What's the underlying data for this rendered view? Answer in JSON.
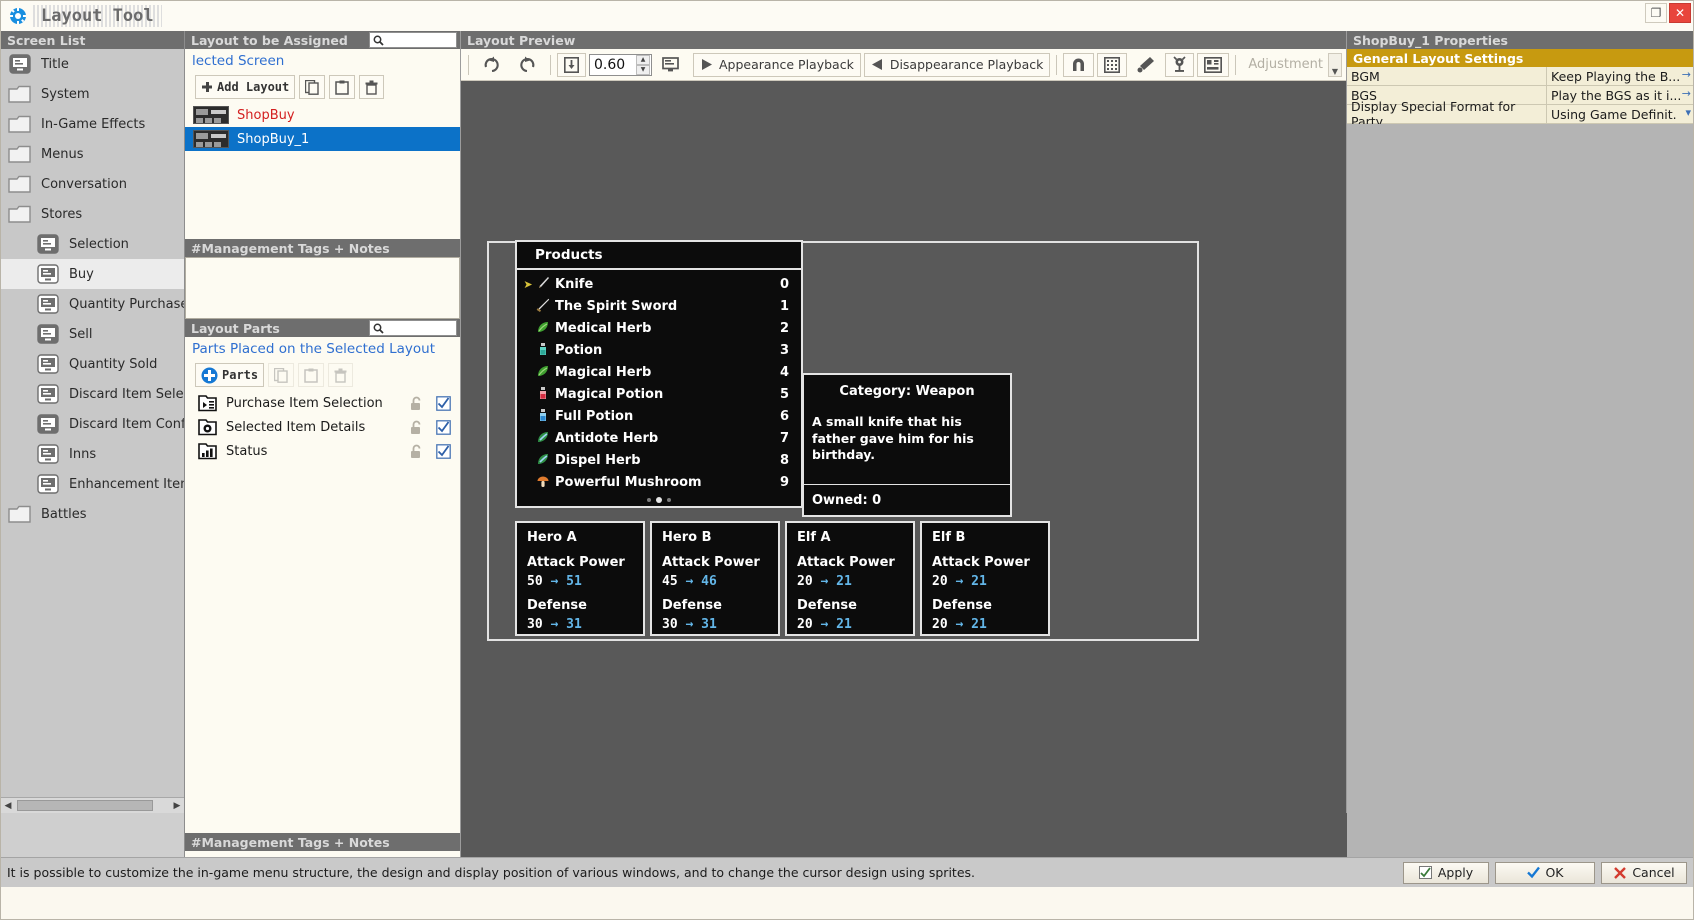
{
  "window": {
    "title": "Layout Tool",
    "logo_icon": "blue-gear-icon",
    "restore_label": "❐",
    "close_label": "✕"
  },
  "screen_list": {
    "header": "Screen List",
    "items": [
      {
        "label": "Title",
        "icon": "screen-icon",
        "indent": false,
        "selected": false
      },
      {
        "label": "System",
        "icon": "folder-icon",
        "indent": false,
        "selected": false
      },
      {
        "label": "In-Game Effects",
        "icon": "folder-icon",
        "indent": false,
        "selected": false
      },
      {
        "label": "Menus",
        "icon": "folder-icon",
        "indent": false,
        "selected": false
      },
      {
        "label": "Conversation",
        "icon": "folder-icon",
        "indent": false,
        "selected": false
      },
      {
        "label": "Stores",
        "icon": "folder-icon",
        "indent": false,
        "selected": false
      },
      {
        "label": "Selection",
        "icon": "screen-icon",
        "indent": true,
        "selected": false
      },
      {
        "label": "Buy",
        "icon": "screen-icon",
        "indent": true,
        "selected": true
      },
      {
        "label": "Quantity Purchased",
        "icon": "screen-icon",
        "indent": true,
        "selected": false
      },
      {
        "label": "Sell",
        "icon": "screen-icon",
        "indent": true,
        "selected": false
      },
      {
        "label": "Quantity Sold",
        "icon": "screen-icon",
        "indent": true,
        "selected": false
      },
      {
        "label": "Discard Item Selectio",
        "icon": "screen-icon",
        "indent": true,
        "selected": false
      },
      {
        "label": "Discard Item Confirm",
        "icon": "screen-icon",
        "indent": true,
        "selected": false
      },
      {
        "label": "Inns",
        "icon": "screen-icon",
        "indent": true,
        "selected": false
      },
      {
        "label": "Enhancement Item S",
        "icon": "screen-icon",
        "indent": true,
        "selected": false
      },
      {
        "label": "Battles",
        "icon": "folder-icon",
        "indent": false,
        "selected": false
      }
    ]
  },
  "layout_assign": {
    "header": "Layout to be Assigned",
    "search_placeholder": "",
    "search_value": "",
    "subtitle": "lected Screen",
    "add_button": "Add Layout",
    "copy_icon": "copy-icon",
    "paste_icon": "paste-icon",
    "delete_icon": "trash-icon",
    "layouts": [
      {
        "name": "ShopBuy",
        "selected": false
      },
      {
        "name": "ShopBuy_1",
        "selected": true
      }
    ],
    "notes_header": "#Management Tags + Notes",
    "notes_value": ""
  },
  "layout_parts": {
    "header": "Layout Parts",
    "search_value": "",
    "subtitle": "Parts Placed on the Selected Layout",
    "add_button": "Parts",
    "copy_icon": "copy-icon",
    "paste_icon": "paste-icon",
    "delete_icon": "trash-icon",
    "items": [
      {
        "label": "Purchase Item Selection",
        "icon": "part-list-icon"
      },
      {
        "label": "Selected Item Details",
        "icon": "part-detail-icon"
      },
      {
        "label": "Status",
        "icon": "part-status-icon"
      }
    ],
    "notes_header_bottom": "#Management Tags + Notes"
  },
  "preview": {
    "header": "Layout Preview",
    "undo_icon": "redo-arrow-icon",
    "redo_icon": "undo-arrow-icon",
    "fit_icon": "fit-to-screen-icon",
    "zoom_value": "0.60",
    "display_icon": "monitor-icon",
    "appearance_playback": "Appearance Playback",
    "disappearance_playback": "Disappearance Playback",
    "magnet_icon": "magnet-icon",
    "grid_icon": "grid-icon",
    "ruler_icon": "ruler-pen-icon",
    "anchor_icon": "pin-marker-icon",
    "layout_icon": "layout-frame-icon",
    "adjustment_label": "Adjustment"
  },
  "game": {
    "products_title": "Products",
    "products": [
      {
        "name": "Knife",
        "qty": "0",
        "icon": "knife-icon",
        "cursor": true
      },
      {
        "name": "The Spirit Sword",
        "qty": "1",
        "icon": "sword-icon",
        "cursor": false
      },
      {
        "name": "Medical Herb",
        "qty": "2",
        "icon": "herb-icon",
        "cursor": false
      },
      {
        "name": "Potion",
        "qty": "3",
        "icon": "potion-icon",
        "cursor": false
      },
      {
        "name": "Magical Herb",
        "qty": "4",
        "icon": "herb-icon",
        "cursor": false
      },
      {
        "name": "Magical Potion",
        "qty": "5",
        "icon": "potion-red-icon",
        "cursor": false
      },
      {
        "name": "Full Potion",
        "qty": "6",
        "icon": "potion-blue-icon",
        "cursor": false
      },
      {
        "name": "Antidote Herb",
        "qty": "7",
        "icon": "herb-blue-icon",
        "cursor": false
      },
      {
        "name": "Dispel Herb",
        "qty": "8",
        "icon": "herb-blue-icon",
        "cursor": false
      },
      {
        "name": "Powerful Mushroom",
        "qty": "9",
        "icon": "mushroom-icon",
        "cursor": false
      }
    ],
    "page_dots": {
      "count": 3,
      "active": 1
    },
    "category": "Category: Weapon",
    "description": "A small knife that his father gave him for his birthday.",
    "owned": "Owned: 0",
    "heroes": [
      {
        "name": "Hero A",
        "stat1_label": "Attack Power",
        "stat1_from": "50",
        "stat1_to": "51",
        "stat2_label": "Defense",
        "stat2_from": "30",
        "stat2_to": "31"
      },
      {
        "name": "Hero B",
        "stat1_label": "Attack Power",
        "stat1_from": "45",
        "stat1_to": "46",
        "stat2_label": "Defense",
        "stat2_from": "30",
        "stat2_to": "31"
      },
      {
        "name": "Elf A",
        "stat1_label": "Attack Power",
        "stat1_from": "20",
        "stat1_to": "21",
        "stat2_label": "Defense",
        "stat2_from": "20",
        "stat2_to": "21"
      },
      {
        "name": "Elf B",
        "stat1_label": "Attack Power",
        "stat1_from": "20",
        "stat1_to": "21",
        "stat2_label": "Defense",
        "stat2_from": "20",
        "stat2_to": "21"
      }
    ],
    "arrow_glyph": "→"
  },
  "properties": {
    "header": "ShopBuy_1 Properties",
    "category": "General Layout Settings",
    "rows": [
      {
        "key": "BGM",
        "value": "Keep Playing the B...",
        "more": "→"
      },
      {
        "key": "BGS",
        "value": "Play the BGS as it i...",
        "more": "→"
      },
      {
        "key": "Display Special Format for Party",
        "value": "Using Game Definit.",
        "more": "▾"
      }
    ]
  },
  "statusbar": {
    "message": "It is possible to customize the in-game menu structure, the design and display position of various windows, and to change the cursor design using sprites.",
    "apply": "Apply",
    "ok": "OK",
    "cancel": "Cancel",
    "apply_icon": "apply-icon",
    "ok_icon": "check-icon",
    "cancel_icon": "cross-icon"
  },
  "colors": {
    "accent_blue": "#0c72c8",
    "link_blue": "#2f6fd0",
    "category_gold": "#c79a10",
    "red_label": "#d32020",
    "stat_blue": "#63b6e8"
  }
}
